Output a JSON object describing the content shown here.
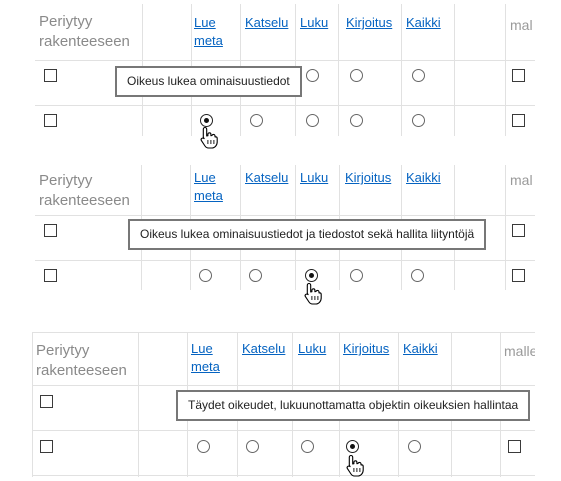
{
  "inherit_label": "Periytyy\nrakenteeseen",
  "columns": [
    "Lue\nmeta",
    "Katselu",
    "Luku",
    "Kirjoitus",
    "Kaikki"
  ],
  "truncated_column": "mal",
  "truncated_column_long": "malle",
  "panels": [
    {
      "tooltip": "Oikeus lukea ominaisuustiedot",
      "selected": "Lue meta"
    },
    {
      "tooltip": "Oikeus lukea ominaisuustiedot ja tiedostot sekä hallita liityntöjä",
      "selected": "Luku"
    },
    {
      "tooltip": "Täydet oikeudet, lukuunottamatta objektin oikeuksien hallintaa",
      "selected": "Kirjoitus"
    }
  ],
  "icons": {
    "cursor": "hand-pointer-icon"
  }
}
